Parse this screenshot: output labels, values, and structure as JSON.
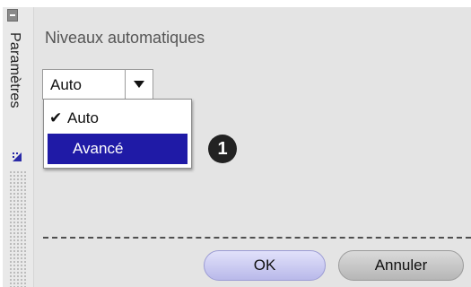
{
  "sidebar": {
    "label": "Paramètres"
  },
  "panel": {
    "title": "Niveaux automatiques",
    "dropdown": {
      "selected": "Auto",
      "options": [
        {
          "label": "Auto",
          "checked": true
        },
        {
          "label": "Avancé",
          "highlighted": true
        }
      ]
    },
    "callout": "1"
  },
  "buttons": {
    "ok": "OK",
    "cancel": "Annuler"
  },
  "colors": {
    "highlight": "#1f1aa6",
    "panel_bg": "#e4e4e4"
  }
}
